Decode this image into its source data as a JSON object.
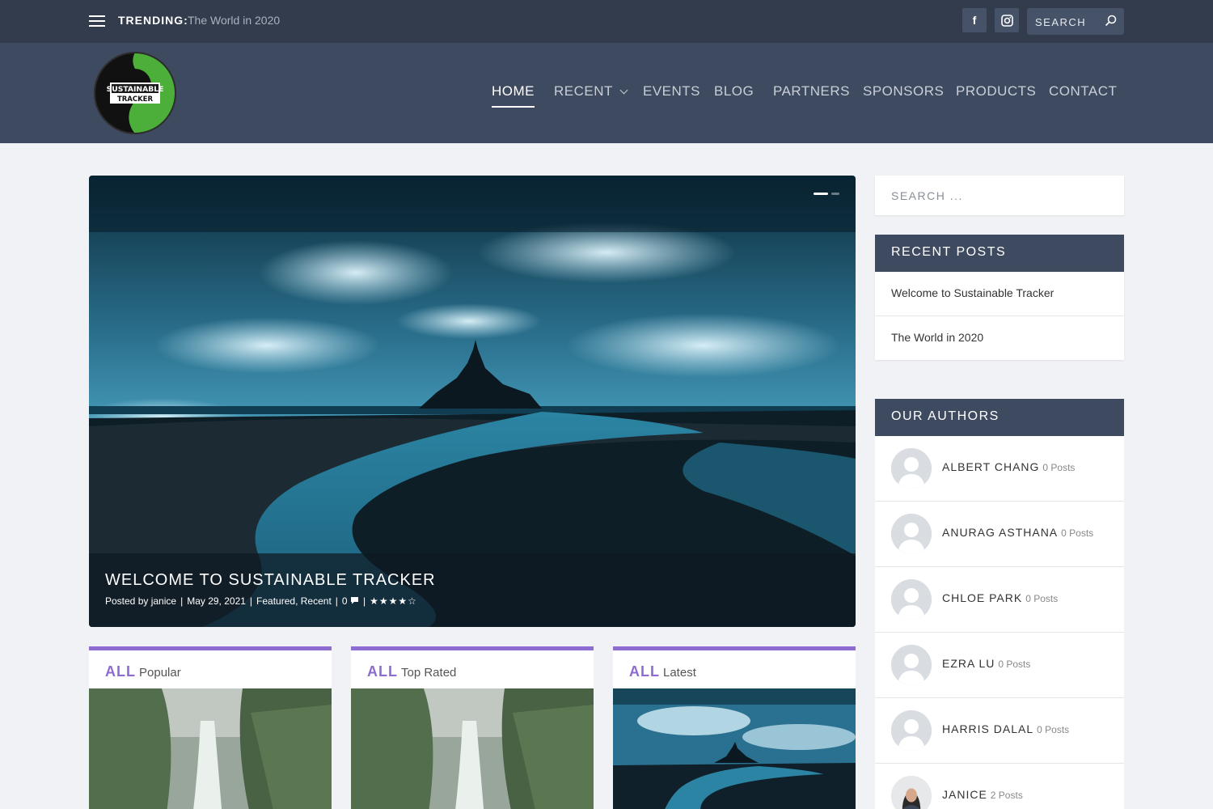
{
  "topbar": {
    "trending_label": "TRENDING:",
    "trending_link": "The World in 2020",
    "social": [
      "facebook-icon",
      "instagram-icon"
    ],
    "search_placeholder": "SEARCH"
  },
  "header": {
    "logo_line1": "SUSTAINABLE",
    "logo_line2": "TRACKER",
    "nav": [
      {
        "label": "HOME",
        "active": true
      },
      {
        "label": "RECENT",
        "dropdown": true
      },
      {
        "label": "EVENTS"
      },
      {
        "label": "BLOG"
      },
      {
        "label": "PARTNERS"
      },
      {
        "label": "SPONSORS"
      },
      {
        "label": "PRODUCTS"
      },
      {
        "label": "CONTACT"
      }
    ]
  },
  "hero": {
    "title": "WELCOME TO SUSTAINABLE TRACKER",
    "posted_by": "Posted by",
    "author": "janice",
    "date": "May 29, 2021",
    "cat1": "Featured",
    "cat2": "Recent",
    "comments": "0",
    "stars": "★★★★☆",
    "rating": 4.5
  },
  "cards": [
    {
      "all": "ALL",
      "sub": "Popular",
      "image": "waterfall"
    },
    {
      "all": "ALL",
      "sub": "Top Rated",
      "image": "waterfall"
    },
    {
      "all": "ALL",
      "sub": "Latest",
      "image": "island"
    }
  ],
  "sidebar": {
    "search_placeholder": "SEARCH ...",
    "recent_title": "RECENT POSTS",
    "recent_posts": [
      "Welcome to Sustainable Tracker",
      "The World in 2020"
    ],
    "authors_title": "OUR AUTHORS",
    "authors": [
      {
        "name": "ALBERT CHANG",
        "count": "0 Posts"
      },
      {
        "name": "ANURAG ASTHANA",
        "count": "0 Posts"
      },
      {
        "name": "CHLOE PARK",
        "count": "0 Posts"
      },
      {
        "name": "EZRA LU",
        "count": "0 Posts"
      },
      {
        "name": "HARRIS DALAL",
        "count": "0 Posts"
      },
      {
        "name": "JANICE",
        "count": "2 Posts"
      }
    ]
  },
  "colors": {
    "topbar": "#333c4c",
    "header": "#3e4a5f",
    "accent": "#8d6bd0",
    "logo_green": "#4caf3a"
  }
}
